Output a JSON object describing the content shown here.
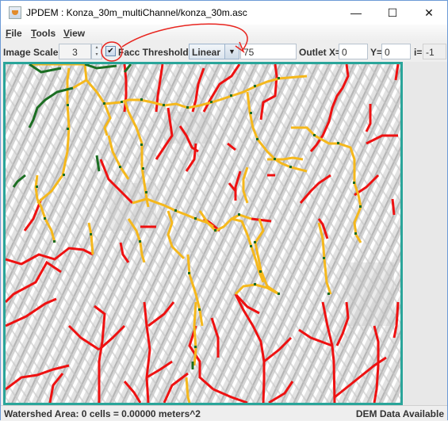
{
  "window": {
    "title": "JPDEM : Konza_30m_multiChannel/konza_30m.asc",
    "minimize_glyph": "—",
    "maximize_glyph": "☐",
    "close_glyph": "✕"
  },
  "menu": {
    "items": [
      {
        "label": "File",
        "mnemonic": "F",
        "rest": "ile"
      },
      {
        "label": "Tools",
        "mnemonic": "T",
        "rest": "ools"
      },
      {
        "label": "View",
        "mnemonic": "V",
        "rest": "iew"
      }
    ]
  },
  "toolbar": {
    "image_scale_label": "Image Scale",
    "image_scale_value": "3",
    "facc_checked_glyph": "✔",
    "facc_label": "Facc Threshold",
    "facc_checked": true,
    "scale_mode": "Linear",
    "threshold_value": "75",
    "outlet_x_label": "Outlet X=",
    "outlet_x_value": "0",
    "outlet_y_label": "Y=",
    "outlet_y_value": "0",
    "i_label": "i=",
    "i_value": "-1"
  },
  "map": {
    "colors": {
      "low_order_stream": "#ee1111",
      "mid_order_stream": "#f5b81c",
      "high_order_stream": "#1b6e22",
      "node": "#1b6e22",
      "frame": "#2aa59a"
    }
  },
  "status": {
    "left": "Watershed Area: 0 cells = 0.00000 meters^2",
    "right": "DEM Data Available"
  }
}
